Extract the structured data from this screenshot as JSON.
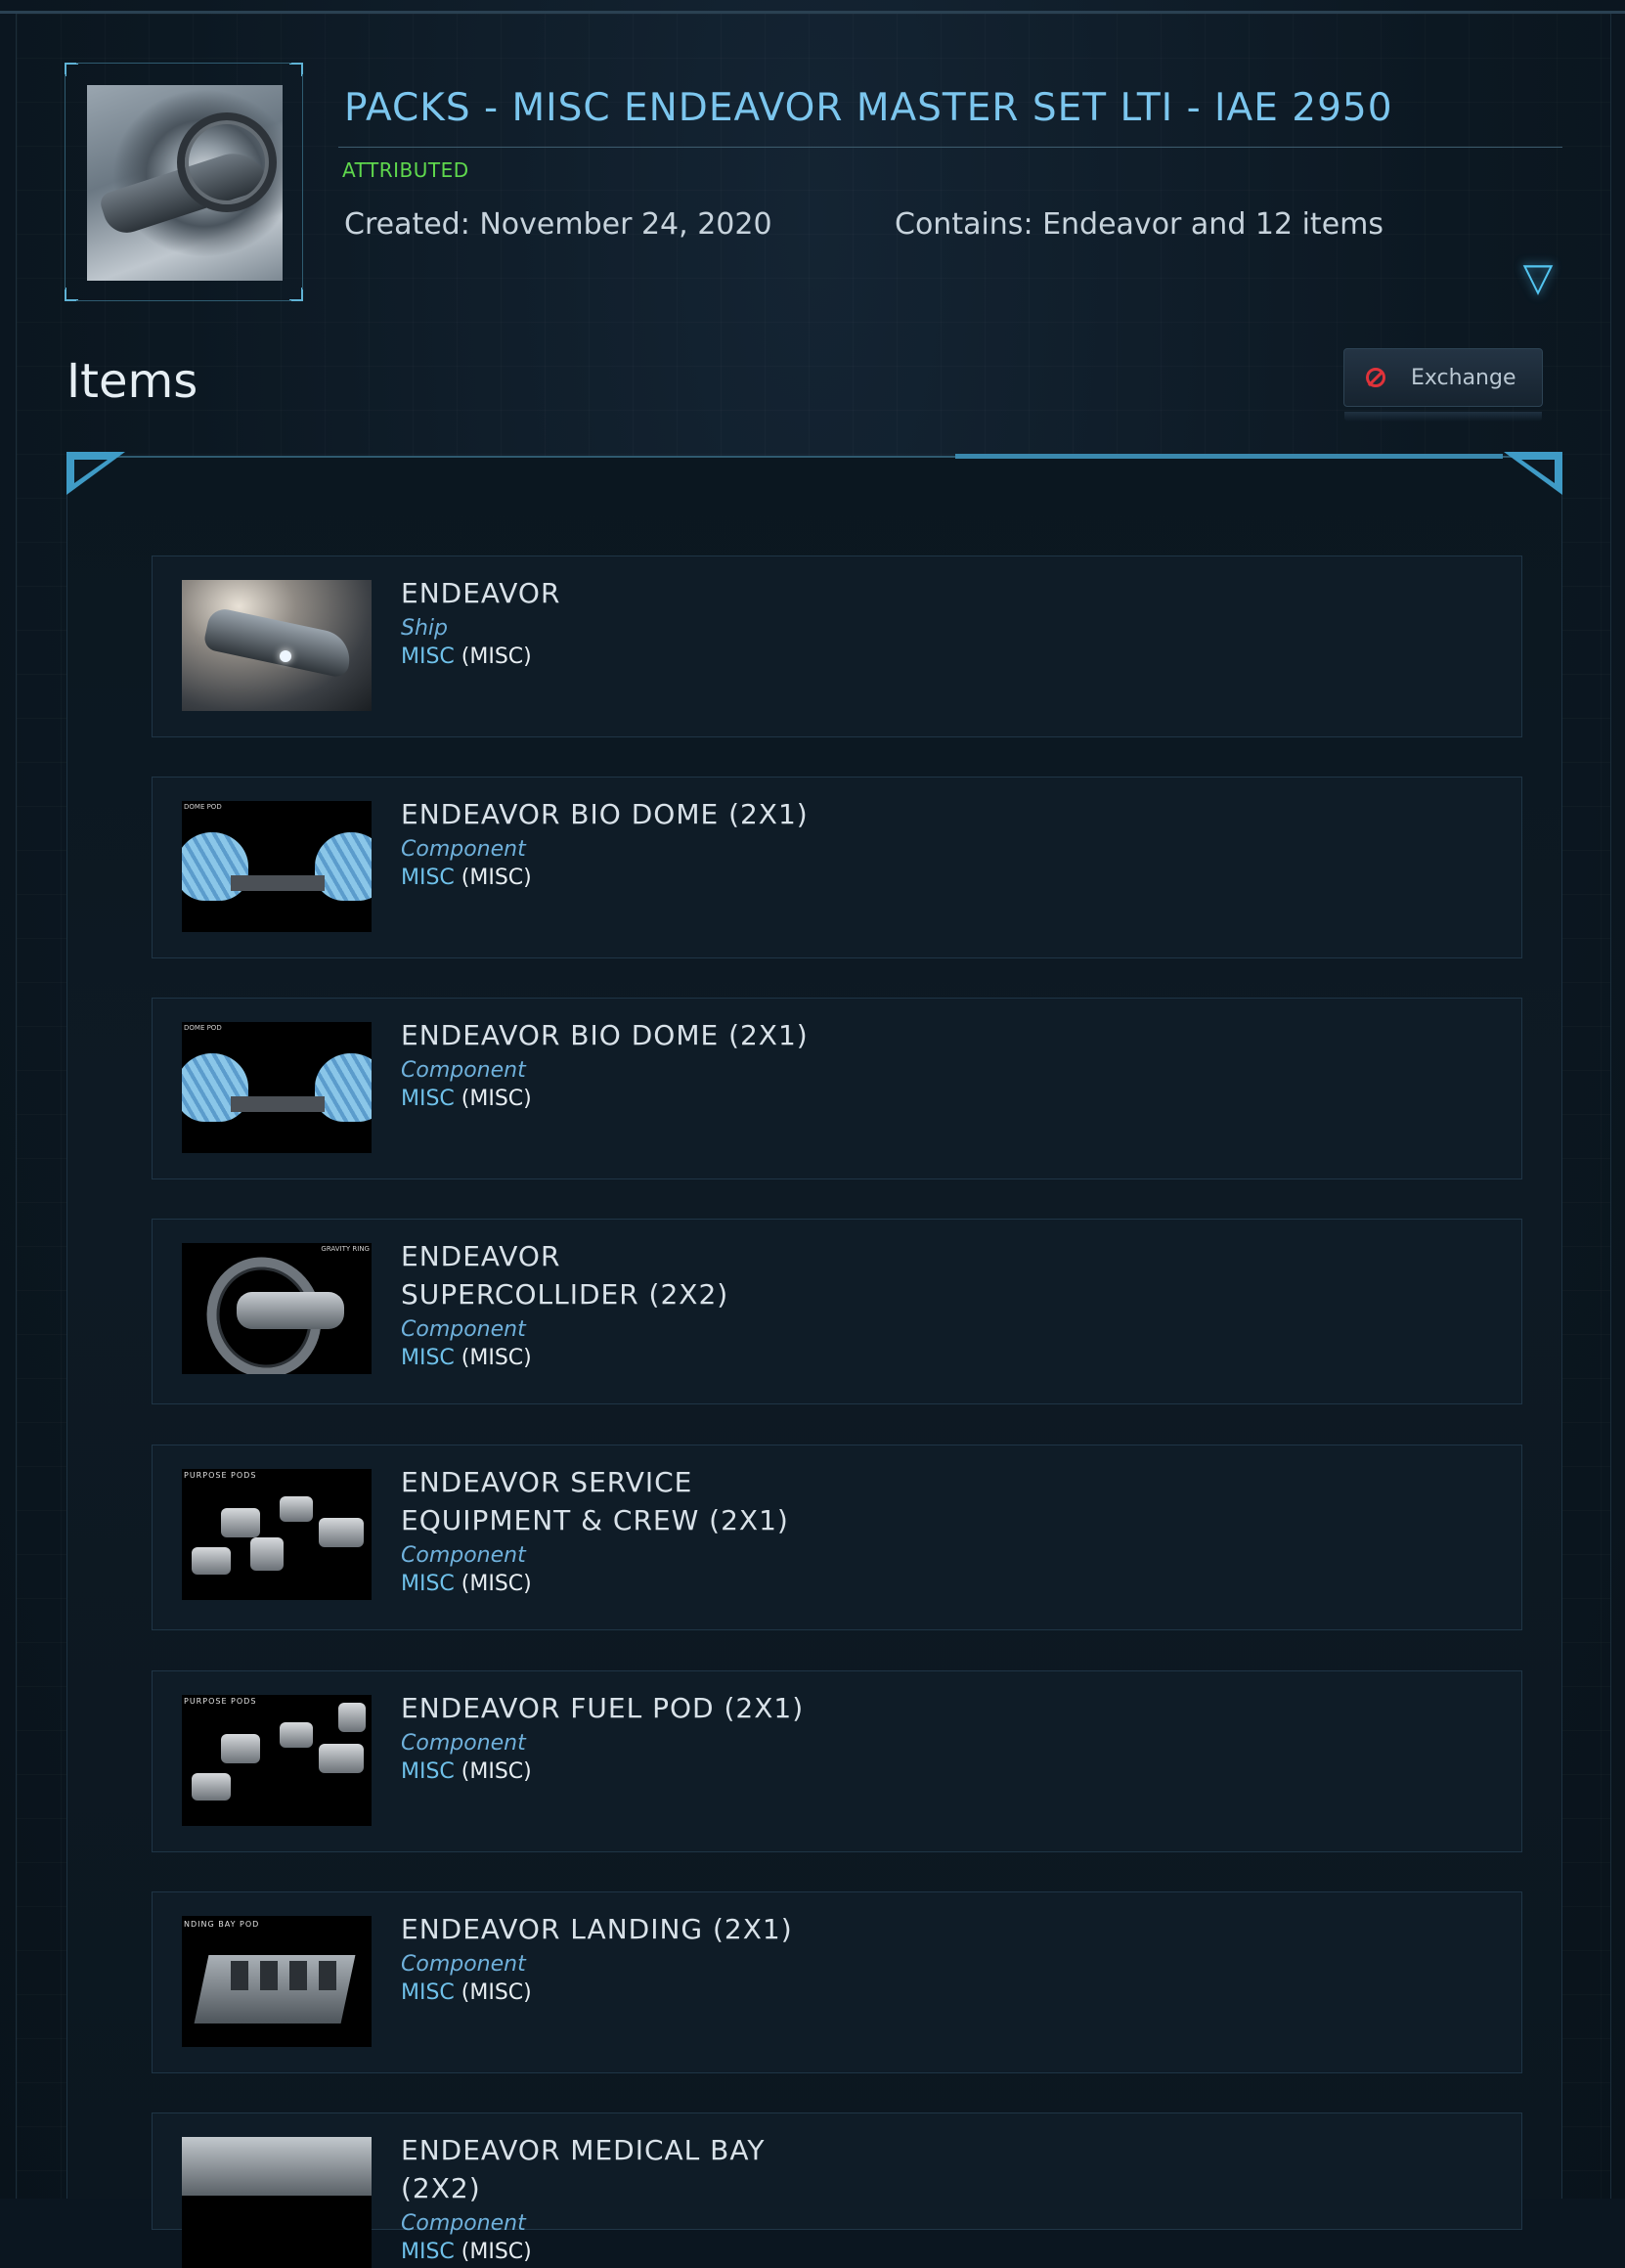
{
  "pack": {
    "title": "PACKS - MISC ENDEAVOR MASTER SET LTI - IAE 2950",
    "status": "ATTRIBUTED",
    "created": "Created: November 24, 2020",
    "contains": "Contains: Endeavor and 12 items",
    "expand_icon": "▽"
  },
  "items_section": {
    "heading": "Items",
    "exchange_label": "Exchange"
  },
  "items": [
    {
      "name": "ENDEAVOR",
      "type": "Ship",
      "mfr": "MISC",
      "mfr_code": "MISC",
      "thumb": "endeavor-ship-image"
    },
    {
      "name": "ENDEAVOR BIO DOME (2X1)",
      "type": "Component",
      "mfr": "MISC",
      "mfr_code": "MISC",
      "thumb": "bio-dome-image"
    },
    {
      "name": "ENDEAVOR BIO DOME (2X1)",
      "type": "Component",
      "mfr": "MISC",
      "mfr_code": "MISC",
      "thumb": "bio-dome-image"
    },
    {
      "name": "ENDEAVOR SUPERCOLLIDER (2X2)",
      "type": "Component",
      "mfr": "MISC",
      "mfr_code": "MISC",
      "thumb": "supercollider-image"
    },
    {
      "name": "ENDEAVOR SERVICE EQUIPMENT & CREW (2X1)",
      "type": "Component",
      "mfr": "MISC",
      "mfr_code": "MISC",
      "thumb": "service-pod-image"
    },
    {
      "name": "ENDEAVOR FUEL POD (2X1)",
      "type": "Component",
      "mfr": "MISC",
      "mfr_code": "MISC",
      "thumb": "fuel-pod-image"
    },
    {
      "name": "ENDEAVOR LANDING (2X1)",
      "type": "Component",
      "mfr": "MISC",
      "mfr_code": "MISC",
      "thumb": "landing-bay-image"
    },
    {
      "name": "ENDEAVOR MEDICAL BAY (2X2)",
      "type": "Component",
      "mfr": "MISC",
      "mfr_code": "MISC",
      "thumb": "medical-bay-image"
    }
  ],
  "thumb_captions": {
    "dome": "DOME POD",
    "gravity": "GRAVITY RING",
    "pods": "PURPOSE PODS",
    "landing": "NDING BAY POD"
  },
  "colors": {
    "title": "#7cc6ee",
    "attributed": "#5fd84d",
    "accent": "#3f9bc6",
    "ban": "#e0333a"
  }
}
